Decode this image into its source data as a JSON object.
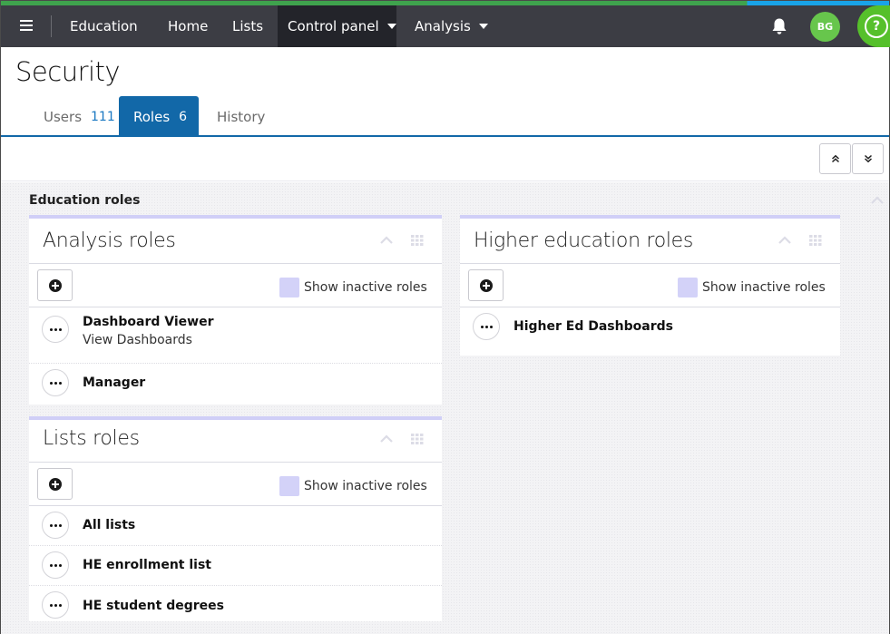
{
  "nav": {
    "menu_icon": "hamburger-menu-icon",
    "app_name": "Education",
    "items": [
      {
        "label": "Home"
      },
      {
        "label": "Lists"
      },
      {
        "label": "Control panel"
      },
      {
        "label": "Analysis"
      }
    ],
    "avatar_initials": "BG",
    "help_glyph": "?",
    "accent_colors": [
      "#3fa34d",
      "#19a3e8"
    ]
  },
  "page": {
    "title": "Security"
  },
  "tabs": [
    {
      "label": "Users",
      "count": "111"
    },
    {
      "label": "Roles",
      "count": "6"
    },
    {
      "label": "History",
      "count": ""
    }
  ],
  "section": {
    "title": "Education roles"
  },
  "panels": {
    "analysis": {
      "title": "Analysis roles",
      "inactive_label": "Show inactive roles",
      "roles": [
        {
          "name": "Dashboard Viewer",
          "description": "View Dashboards"
        },
        {
          "name": "Manager"
        }
      ]
    },
    "lists": {
      "title": "Lists roles",
      "inactive_label": "Show inactive roles",
      "roles": [
        {
          "name": "All lists"
        },
        {
          "name": "HE enrollment list"
        },
        {
          "name": "HE student degrees"
        }
      ]
    },
    "higher_ed": {
      "title": "Higher education roles",
      "inactive_label": "Show inactive roles",
      "roles": [
        {
          "name": "Higher Ed Dashboards"
        }
      ]
    }
  },
  "colors": {
    "topbar": "#3c3d44",
    "active_tab": "#1268a8",
    "count_blue": "#1a78c2",
    "panel_accent": "#d0cff7",
    "avatar": "#67c64c",
    "help": "#56c02b"
  }
}
